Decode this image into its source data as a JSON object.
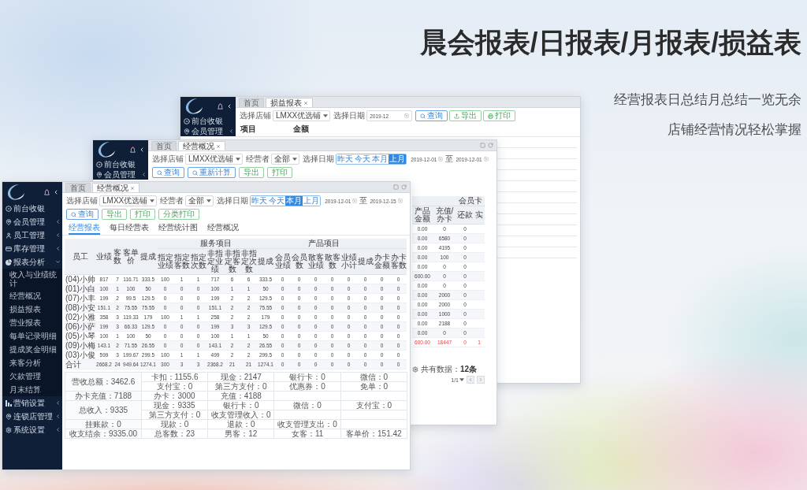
{
  "headline": {
    "title": "晨会报表/日报表/月报表/损益表",
    "lines": [
      "经营报表日总结月总结一览无余",
      "店铺经营情况轻松掌握"
    ]
  },
  "back_window": {
    "sidebar": {
      "items": [
        {
          "label": "前台收银"
        },
        {
          "label": "会员管理",
          "expanded": false
        }
      ]
    },
    "tabs": [
      {
        "label": "首页",
        "selected": false
      },
      {
        "label": "损益报表",
        "selected": true,
        "closable": true
      }
    ],
    "filters": {
      "store_label": "选择店铺",
      "store": "LMXX优选铺",
      "date_label": "选择日期",
      "month": "2019-12"
    },
    "buttons": [
      {
        "label": "查询",
        "kind": "search"
      },
      {
        "label": "导出",
        "kind": "export"
      },
      {
        "label": "打印",
        "kind": "print"
      }
    ],
    "table_header": [
      "项目",
      "金额"
    ]
  },
  "middle_window": {
    "sidebar": {
      "items": [
        {
          "label": "前台收银"
        },
        {
          "label": "会员管理",
          "expanded": false
        }
      ]
    },
    "tabs": [
      {
        "label": "首页",
        "selected": false
      },
      {
        "label": "经营概况",
        "selected": true,
        "closable": true
      }
    ],
    "filters": {
      "store_label": "选择店铺",
      "store": "LMXX优选铺",
      "operator_label": "经营者",
      "operator": "全部",
      "date_label": "选择日期",
      "periods": [
        {
          "label": "昨天",
          "selected": false
        },
        {
          "label": "今天",
          "selected": false
        },
        {
          "label": "本月",
          "selected": false
        },
        {
          "label": "上月",
          "selected": true
        }
      ],
      "date_from": "2019-12-01",
      "date_sep": "至",
      "date_to": "2019-12-01"
    },
    "buttons": [
      {
        "label": "查询",
        "kind": "search"
      },
      {
        "label": "重新计算",
        "kind": "search"
      },
      {
        "label": "导出",
        "kind": "plain"
      },
      {
        "label": "打印",
        "kind": "plain"
      }
    ],
    "member_card_table": {
      "group": "会员卡",
      "columns": [
        "产品金额",
        "充值/办卡",
        "还款",
        "实"
      ],
      "rows": [
        [
          "0.00",
          "0",
          "0"
        ],
        [
          "0.00",
          "6580",
          "0"
        ],
        [
          "0.00",
          "4195",
          "0"
        ],
        [
          "0.00",
          "100",
          "0"
        ],
        [
          "0.00",
          "0",
          "0"
        ],
        [
          "600.00",
          "0",
          "0"
        ],
        [
          "0.00",
          "0",
          "0"
        ],
        [
          "0.00",
          "2000",
          "0"
        ],
        [
          "0.00",
          "2000",
          "0"
        ],
        [
          "0.00",
          "1000",
          "0"
        ],
        [
          "0.00",
          "2188",
          "0"
        ],
        [
          "0.00",
          "0",
          "0"
        ]
      ],
      "total": [
        "600.00",
        "18447",
        "0",
        "1"
      ]
    },
    "pagination": {
      "summary": "共有数据：**12条**",
      "page": "1/1"
    }
  },
  "front_window": {
    "sidebar": {
      "items": [
        {
          "label": "前台收银"
        },
        {
          "label": "会员管理",
          "expanded": false
        },
        {
          "label": "员工管理",
          "expanded": false
        },
        {
          "label": "库存管理",
          "expanded": false
        },
        {
          "label": "报表分析",
          "expanded": true,
          "children": [
            {
              "label": "收入与业绩统计"
            },
            {
              "label": "经营概况"
            },
            {
              "label": "损益报表"
            },
            {
              "label": "营业报表"
            },
            {
              "label": "每单记录明细"
            },
            {
              "label": "提成奖金明细"
            },
            {
              "label": "来客分析"
            },
            {
              "label": "欠款管理"
            },
            {
              "label": "月末结算"
            }
          ]
        },
        {
          "label": "营销设置",
          "expanded": false
        },
        {
          "label": "连锁店管理",
          "expanded": false
        },
        {
          "label": "系统设置",
          "expanded": false
        }
      ]
    },
    "tabs": [
      {
        "label": "首页",
        "selected": false
      },
      {
        "label": "经营概况",
        "selected": true,
        "closable": true
      }
    ],
    "filters": {
      "store_label": "选择店铺",
      "store": "LMXX优选铺",
      "operator_label": "经营者",
      "operator": "全部",
      "date_label": "选择日期",
      "periods": [
        {
          "label": "昨天",
          "selected": false
        },
        {
          "label": "今天",
          "selected": false
        },
        {
          "label": "本月",
          "selected": true
        },
        {
          "label": "上月",
          "selected": false
        }
      ],
      "date_from": "2019-12-01",
      "date_sep": "至",
      "date_to": "2019-12-15"
    },
    "buttons": [
      {
        "label": "查询",
        "kind": "search"
      },
      {
        "label": "导出",
        "kind": "plain"
      },
      {
        "label": "打印",
        "kind": "plain"
      },
      {
        "label": "分类打印",
        "kind": "plain"
      }
    ],
    "subtabs": [
      {
        "label": "经营报表",
        "selected": true
      },
      {
        "label": "每日经营表",
        "selected": false
      },
      {
        "label": "经营统计图",
        "selected": false
      },
      {
        "label": "经营概况",
        "selected": false
      }
    ],
    "table": {
      "columns": [
        "员工",
        "业绩",
        "客数",
        "客单价",
        "提成"
      ],
      "groups": [
        {
          "label": "服务项目",
          "columns": [
            "指定业绩",
            "指定客数",
            "指定次数",
            "非指定业绩",
            "非指定客数",
            "非指定次数",
            "提成"
          ]
        },
        {
          "label": "产品项目",
          "columns": [
            "会员业绩",
            "会员数",
            "散客业绩",
            "散客数",
            "业绩小计",
            "提成"
          ]
        },
        {
          "columns": [
            "办卡金额",
            "办卡客数"
          ]
        }
      ],
      "rows": [
        [
          "(04)小帅",
          "817",
          "7",
          "116.71",
          "333.5",
          "100",
          "1",
          "1",
          "717",
          "6",
          "6",
          "333.5",
          "0",
          "0",
          "0",
          "0",
          "0",
          "0",
          "0",
          "0"
        ],
        [
          "(01)小白",
          "100",
          "1",
          "100",
          "50",
          "0",
          "0",
          "0",
          "100",
          "1",
          "1",
          "50",
          "0",
          "0",
          "0",
          "0",
          "0",
          "0",
          "0",
          "0"
        ],
        [
          "(07)小丰",
          "199",
          "2",
          "99.5",
          "129.5",
          "0",
          "0",
          "0",
          "199",
          "2",
          "2",
          "129.5",
          "0",
          "0",
          "0",
          "0",
          "0",
          "0",
          "0",
          "0"
        ],
        [
          "(08)小安",
          "151.1",
          "2",
          "75.55",
          "75.55",
          "0",
          "0",
          "0",
          "151.1",
          "2",
          "2",
          "75.55",
          "0",
          "0",
          "0",
          "0",
          "0",
          "0",
          "0",
          "0"
        ],
        [
          "(02)小雅",
          "358",
          "3",
          "119.33",
          "179",
          "100",
          "1",
          "1",
          "258",
          "2",
          "2",
          "179",
          "0",
          "0",
          "0",
          "0",
          "0",
          "0",
          "0",
          "0"
        ],
        [
          "(06)小萨",
          "199",
          "3",
          "66.33",
          "129.5",
          "0",
          "0",
          "0",
          "199",
          "3",
          "3",
          "129.5",
          "0",
          "0",
          "0",
          "0",
          "0",
          "0",
          "0",
          "0"
        ],
        [
          "(05)小琴",
          "100",
          "1",
          "100",
          "50",
          "0",
          "0",
          "0",
          "100",
          "1",
          "1",
          "50",
          "0",
          "0",
          "0",
          "0",
          "0",
          "0",
          "0",
          "0"
        ],
        [
          "(09)小梅",
          "143.1",
          "2",
          "71.55",
          "26.55",
          "0",
          "0",
          "0",
          "143.1",
          "2",
          "2",
          "26.55",
          "0",
          "0",
          "0",
          "0",
          "0",
          "0",
          "0",
          "0"
        ],
        [
          "(03)小俊",
          "599",
          "3",
          "199.67",
          "299.5",
          "100",
          "1",
          "1",
          "499",
          "2",
          "2",
          "299.5",
          "0",
          "0",
          "0",
          "0",
          "0",
          "0",
          "0",
          "0"
        ],
        [
          "合计",
          "2668.2",
          "24",
          "949.64",
          "1274.1",
          "300",
          "3",
          "3",
          "2368.2",
          "21",
          "21",
          "1274.1",
          "0",
          "0",
          "0",
          "0",
          "0",
          "0",
          "0",
          "0"
        ]
      ]
    },
    "summary": [
      {
        "head": "营收总额：3462.6",
        "lines": [
          [
            "卡扣：1155.6",
            "现金：2147",
            "银行卡：0",
            "微信：0"
          ],
          [
            "支付宝：0",
            "第三方支付：0",
            "优惠券：0",
            "免单：0"
          ]
        ]
      },
      {
        "head": "办卡充值：7188",
        "lines": [
          [
            "办卡：3000",
            "充值：4188"
          ]
        ]
      },
      {
        "head": "总收入：9335",
        "lines": [
          [
            "现金：9335",
            "银行卡：0",
            "微信：0",
            "支付宝：0"
          ],
          [
            "第三方支付：0",
            "收支管理收入：0"
          ]
        ]
      },
      {
        "head": "挂账款：0",
        "lines": [
          [
            "现款：0",
            "退款：0",
            "收支管理支出：0"
          ]
        ]
      },
      {
        "head": "收支结余：9335.00",
        "lines": [
          [
            "总客数：23",
            "男客：12",
            "女客：11",
            "客单价：151.42"
          ]
        ]
      }
    ]
  }
}
